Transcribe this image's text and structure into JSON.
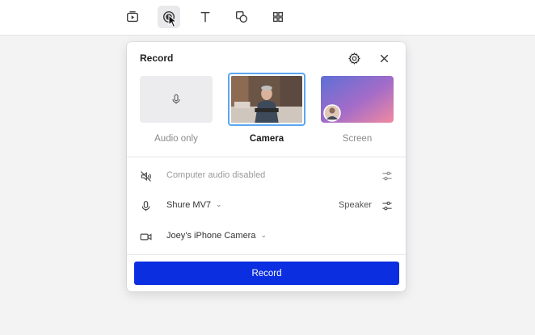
{
  "toolbar": {
    "tools": [
      {
        "name": "video-tool",
        "icon": "video-icon"
      },
      {
        "name": "record-tool",
        "icon": "record-icon",
        "active": true
      },
      {
        "name": "text-tool",
        "icon": "text-icon"
      },
      {
        "name": "shapes-tool",
        "icon": "shapes-icon"
      },
      {
        "name": "grid-tool",
        "icon": "grid-icon"
      }
    ]
  },
  "panel": {
    "title": "Record",
    "options": [
      {
        "label": "Audio only",
        "selected": false
      },
      {
        "label": "Camera",
        "selected": true
      },
      {
        "label": "Screen",
        "selected": false
      }
    ],
    "rows": {
      "computer_audio": "Computer audio disabled",
      "microphone": "Shure MV7",
      "speaker_label": "Speaker",
      "camera": "Joey’s iPhone Camera"
    },
    "record_label": "Record"
  },
  "colors": {
    "accent": "#0b2ee0",
    "selection_border": "#5aa7f0"
  }
}
